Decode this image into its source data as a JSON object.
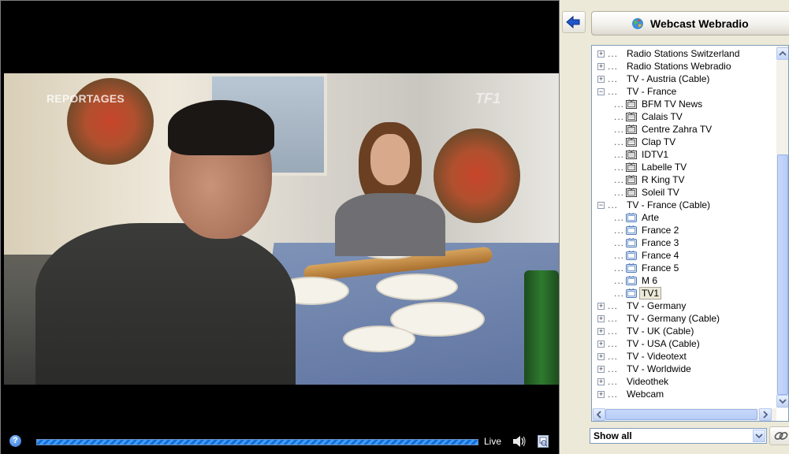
{
  "video": {
    "overlay_left": "REPORTAGES",
    "overlay_right": "TF1"
  },
  "controls": {
    "help_glyph": "?",
    "live_label": "Live",
    "progress_fraction": 0.98
  },
  "panel": {
    "title": "Webcast Webradio",
    "filter": {
      "selected": "Show all"
    }
  },
  "tree": {
    "items": [
      {
        "label": "Radio Stations Switzerland",
        "level": 0,
        "expander": "+"
      },
      {
        "label": "Radio Stations Webradio",
        "level": 0,
        "expander": "+"
      },
      {
        "label": "TV - Austria (Cable)",
        "level": 0,
        "expander": "+"
      },
      {
        "label": "TV - France",
        "level": 0,
        "expander": "−"
      },
      {
        "label": "BFM TV News",
        "level": 1,
        "icon": "tv-channel-icon"
      },
      {
        "label": "Calais TV",
        "level": 1,
        "icon": "tv-channel-icon"
      },
      {
        "label": "Centre Zahra TV",
        "level": 1,
        "icon": "tv-channel-icon"
      },
      {
        "label": "Clap TV",
        "level": 1,
        "icon": "tv-channel-icon"
      },
      {
        "label": "IDTV1",
        "level": 1,
        "icon": "tv-channel-icon"
      },
      {
        "label": "Labelle TV",
        "level": 1,
        "icon": "tv-channel-icon"
      },
      {
        "label": "R King TV",
        "level": 1,
        "icon": "tv-channel-icon"
      },
      {
        "label": "Soleil TV",
        "level": 1,
        "icon": "tv-channel-icon"
      },
      {
        "label": "TV - France (Cable)",
        "level": 0,
        "expander": "−"
      },
      {
        "label": "Arte",
        "level": 1,
        "icon": "tv-screen-icon"
      },
      {
        "label": "France 2",
        "level": 1,
        "icon": "tv-screen-icon"
      },
      {
        "label": "France 3",
        "level": 1,
        "icon": "tv-screen-icon"
      },
      {
        "label": "France 4",
        "level": 1,
        "icon": "tv-screen-icon"
      },
      {
        "label": "France 5",
        "level": 1,
        "icon": "tv-screen-icon"
      },
      {
        "label": "M 6",
        "level": 1,
        "icon": "tv-screen-icon"
      },
      {
        "label": "TV1",
        "level": 1,
        "icon": "tv-screen-icon",
        "selected": true
      },
      {
        "label": "TV - Germany",
        "level": 0,
        "expander": "+"
      },
      {
        "label": "TV - Germany (Cable)",
        "level": 0,
        "expander": "+"
      },
      {
        "label": "TV - UK (Cable)",
        "level": 0,
        "expander": "+"
      },
      {
        "label": "TV - USA (Cable)",
        "level": 0,
        "expander": "+"
      },
      {
        "label": "TV - Videotext",
        "level": 0,
        "expander": "+"
      },
      {
        "label": "TV - Worldwide",
        "level": 0,
        "expander": "+"
      },
      {
        "label": "Videothek",
        "level": 0,
        "expander": "+"
      },
      {
        "label": "Webcam",
        "level": 0,
        "expander": "+"
      }
    ]
  },
  "colors": {
    "accent": "#2f6fd0",
    "panel_bg": "#ece9d8",
    "tree_border": "#7f9db9"
  }
}
